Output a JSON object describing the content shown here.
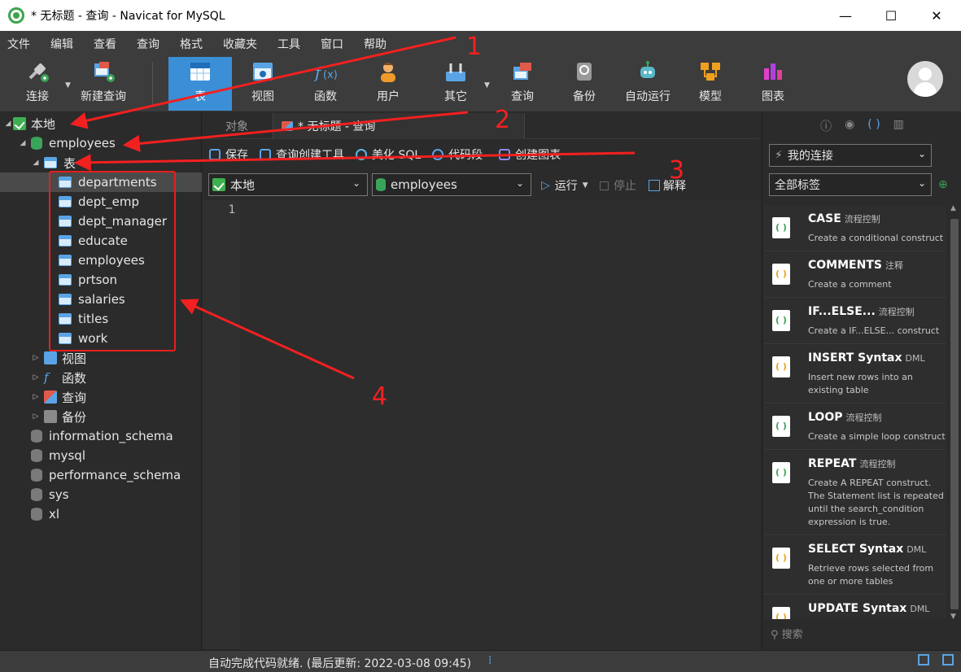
{
  "window": {
    "title": "* 无标题 - 查询 - Navicat for MySQL",
    "minimize": "—",
    "maximize": "☐",
    "close": "✕"
  },
  "menu": [
    "文件",
    "编辑",
    "查看",
    "查询",
    "格式",
    "收藏夹",
    "工具",
    "窗口",
    "帮助"
  ],
  "toolbar": {
    "connect": "连接",
    "new_query": "新建查询",
    "table": "表",
    "view": "视图",
    "function": "函数",
    "user": "用户",
    "other": "其它",
    "query": "查询",
    "backup": "备份",
    "automation": "自动运行",
    "model": "模型",
    "chart": "图表"
  },
  "navigator": {
    "connection": "本地",
    "database": "employees",
    "tables_node": "表",
    "tables": [
      "departments",
      "dept_emp",
      "dept_manager",
      "educate",
      "employees",
      "prtson",
      "salaries",
      "titles",
      "work"
    ],
    "groups": [
      "视图",
      "函数",
      "查询",
      "备份"
    ],
    "other_databases": [
      "information_schema",
      "mysql",
      "performance_schema",
      "sys",
      "xl"
    ]
  },
  "tabs": {
    "objects": "对象",
    "query": "* 无标题 - 查询"
  },
  "editor_toolbar": {
    "save": "保存",
    "query_builder": "查询创建工具",
    "beautify": "美化 SQL",
    "snippet": "代码段",
    "create_chart": "创建图表"
  },
  "run_bar": {
    "connection": "本地",
    "database": "employees",
    "run": "运行",
    "stop": "停止",
    "explain": "解释"
  },
  "editor": {
    "line_number": "1"
  },
  "right_panel": {
    "connection_filter": "我的连接",
    "tag_filter": "全部标签",
    "search_placeholder": "搜索",
    "snippets": [
      {
        "title": "CASE",
        "tag": "流程控制",
        "desc": "Create a conditional construct"
      },
      {
        "title": "COMMENTS",
        "tag": "注释",
        "desc": "Create a comment"
      },
      {
        "title": "IF...ELSE...",
        "tag": "流程控制",
        "desc": "Create a IF...ELSE... construct"
      },
      {
        "title": "INSERT Syntax",
        "tag": "DML",
        "desc": "Insert new rows into an existing table"
      },
      {
        "title": "LOOP",
        "tag": "流程控制",
        "desc": "Create a simple loop construct"
      },
      {
        "title": "REPEAT",
        "tag": "流程控制",
        "desc": "Create A REPEAT construct. The Statement list is repeated until the search_condition expression is true."
      },
      {
        "title": "SELECT Syntax",
        "tag": "DML",
        "desc": "Retrieve rows selected from one or more tables"
      },
      {
        "title": "UPDATE Syntax",
        "tag": "DML",
        "desc": ""
      }
    ]
  },
  "status": {
    "text": "自动完成代码就绪. (最后更新: 2022-03-08 09:45)"
  },
  "annotations": [
    "1",
    "2",
    "3",
    "4"
  ],
  "colors": {
    "accent": "#3a8fd6",
    "annotation_red": "#f32020",
    "db_green": "#3aa45a"
  }
}
